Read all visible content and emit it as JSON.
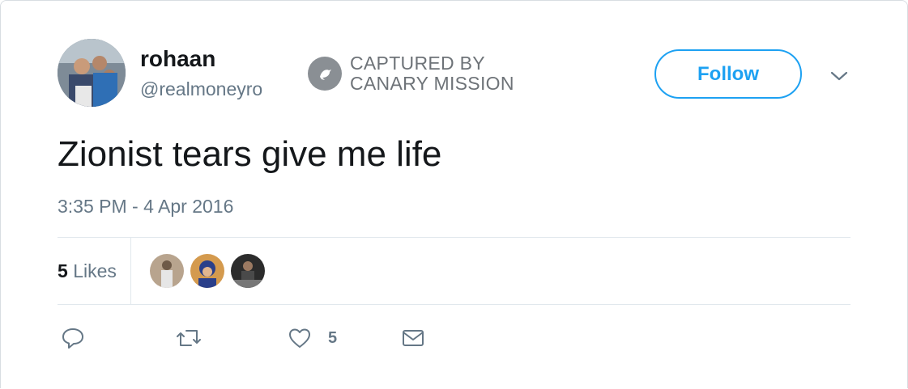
{
  "user": {
    "name": "rohaan",
    "handle": "@realmoneyro"
  },
  "badge": {
    "line1": "CAPTURED BY",
    "line2": "CANARY MISSION"
  },
  "follow_label": "Follow",
  "tweet": {
    "text": "Zionist tears give me life",
    "timestamp": "3:35 PM - 4 Apr 2016"
  },
  "stats": {
    "likes_count": "5",
    "likes_label": "Likes"
  },
  "actions": {
    "like_count": "5"
  },
  "colors": {
    "accent": "#1da1f2",
    "muted": "#657786",
    "text": "#14171a"
  },
  "icons": [
    "chevron-down-icon",
    "canary-bird-icon",
    "reply-icon",
    "retweet-icon",
    "heart-icon",
    "message-icon"
  ]
}
